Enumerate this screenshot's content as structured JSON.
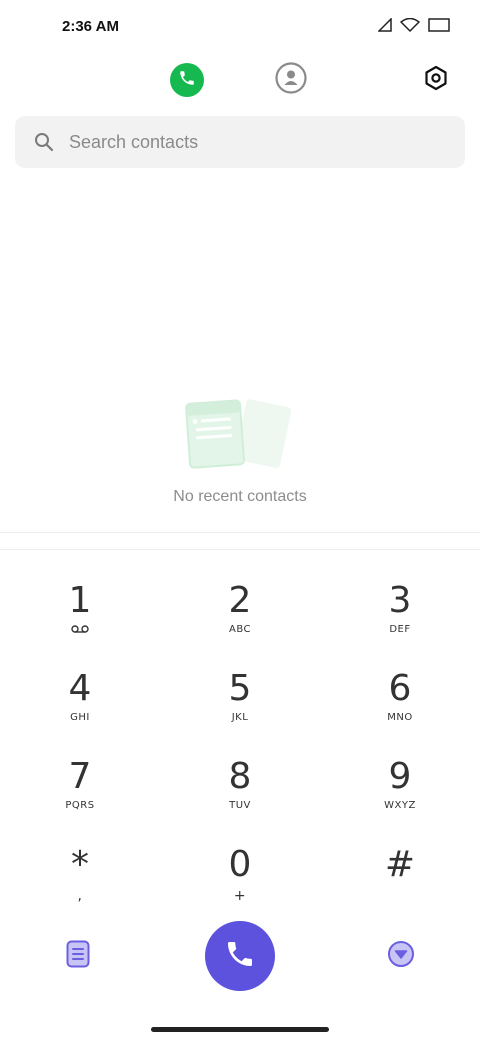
{
  "status_bar": {
    "time": "2:36 AM",
    "icons": [
      "signal-icon",
      "wifi-icon",
      "battery-icon"
    ]
  },
  "top_bar": {
    "tabs": [
      {
        "name": "recents",
        "icon": "phone-icon",
        "active": true
      },
      {
        "name": "contacts",
        "icon": "person-icon",
        "active": false
      }
    ],
    "settings_icon": "gear-icon"
  },
  "search": {
    "placeholder": "Search contacts",
    "value": ""
  },
  "empty_state": {
    "text": "No recent contacts"
  },
  "keypad": {
    "keys": [
      {
        "digit": "1",
        "letters": ""
      },
      {
        "digit": "2",
        "letters": "ABC"
      },
      {
        "digit": "3",
        "letters": "DEF"
      },
      {
        "digit": "4",
        "letters": "GHI"
      },
      {
        "digit": "5",
        "letters": "JKL"
      },
      {
        "digit": "6",
        "letters": "MNO"
      },
      {
        "digit": "7",
        "letters": "PQRS"
      },
      {
        "digit": "8",
        "letters": "TUV"
      },
      {
        "digit": "9",
        "letters": "WXYZ"
      },
      {
        "digit": "*",
        "letters": ","
      },
      {
        "digit": "0",
        "letters": "+"
      },
      {
        "digit": "#",
        "letters": ""
      }
    ]
  },
  "colors": {
    "accent_green": "#16b94f",
    "call_button": "#5d52dd",
    "side_button": "#6a5fe0"
  }
}
